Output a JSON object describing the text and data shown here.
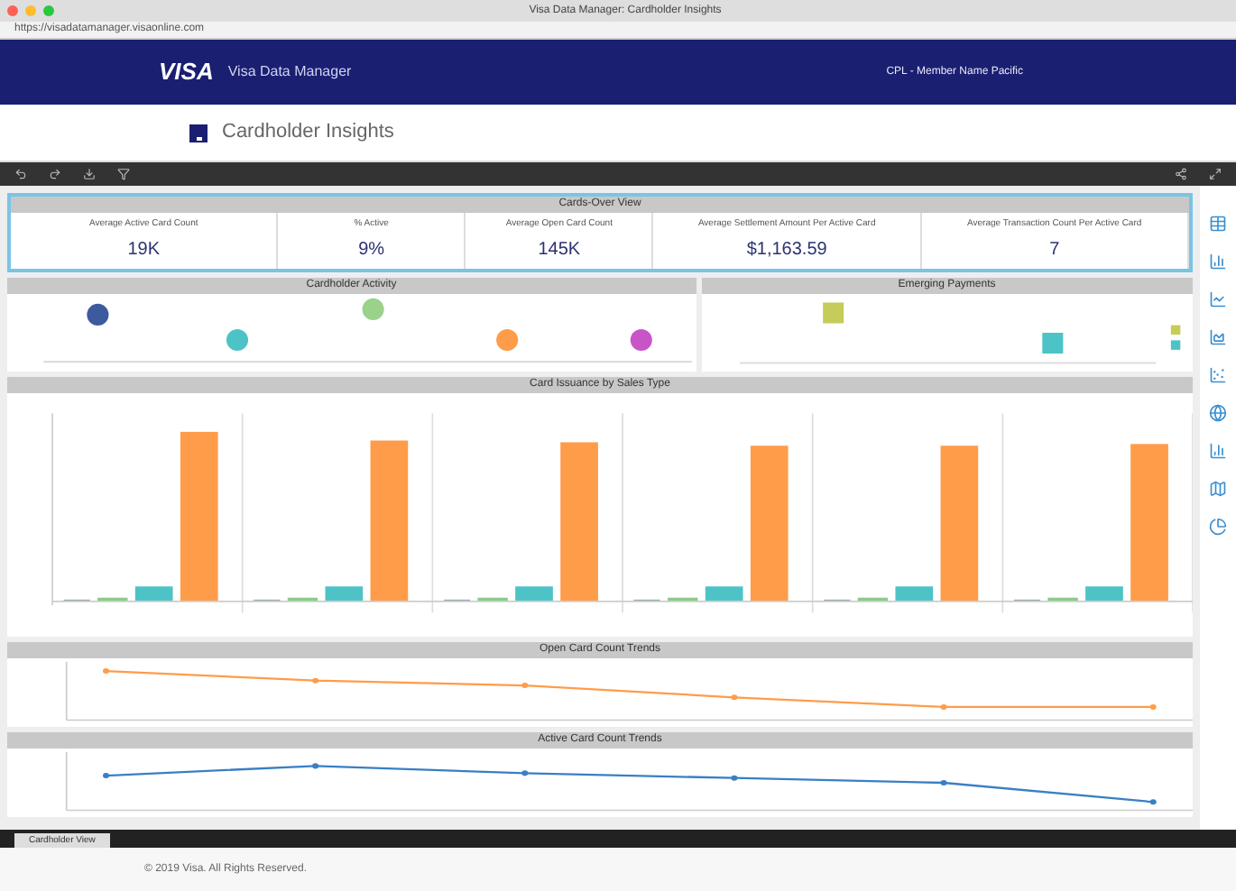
{
  "window": {
    "title": "Visa Data Manager: Cardholder Insights"
  },
  "address_bar": {
    "url": "https://visadatamanager.visaonline.com"
  },
  "header": {
    "brand": "VISA",
    "product": "Visa Data Manager",
    "member": "CPL - Member Name Pacific"
  },
  "page": {
    "title": "Cardholder Insights"
  },
  "overview": {
    "title": "Cards-Over View",
    "kpis": [
      {
        "label": "Average Active Card Count",
        "value": "19K"
      },
      {
        "label": "% Active",
        "value": "9%"
      },
      {
        "label": "Average Open Card Count",
        "value": "145K"
      },
      {
        "label": "Average Settlement Amount Per Active Card",
        "value": "$1,163.59"
      },
      {
        "label": "Average Transaction Count Per Active Card",
        "value": "7"
      }
    ]
  },
  "panels": {
    "activity": "Cardholder Activity",
    "emerging": "Emerging Payments",
    "sales": "Card Issuance by Sales Type",
    "open_trends": "Open Card Count Trends",
    "active_trends": "Active Card Count Trends"
  },
  "sheet_tabs": [
    {
      "label": "Cardholder View",
      "selected": true
    }
  ],
  "footer": "© 2019 Visa. All Rights Reserved."
}
